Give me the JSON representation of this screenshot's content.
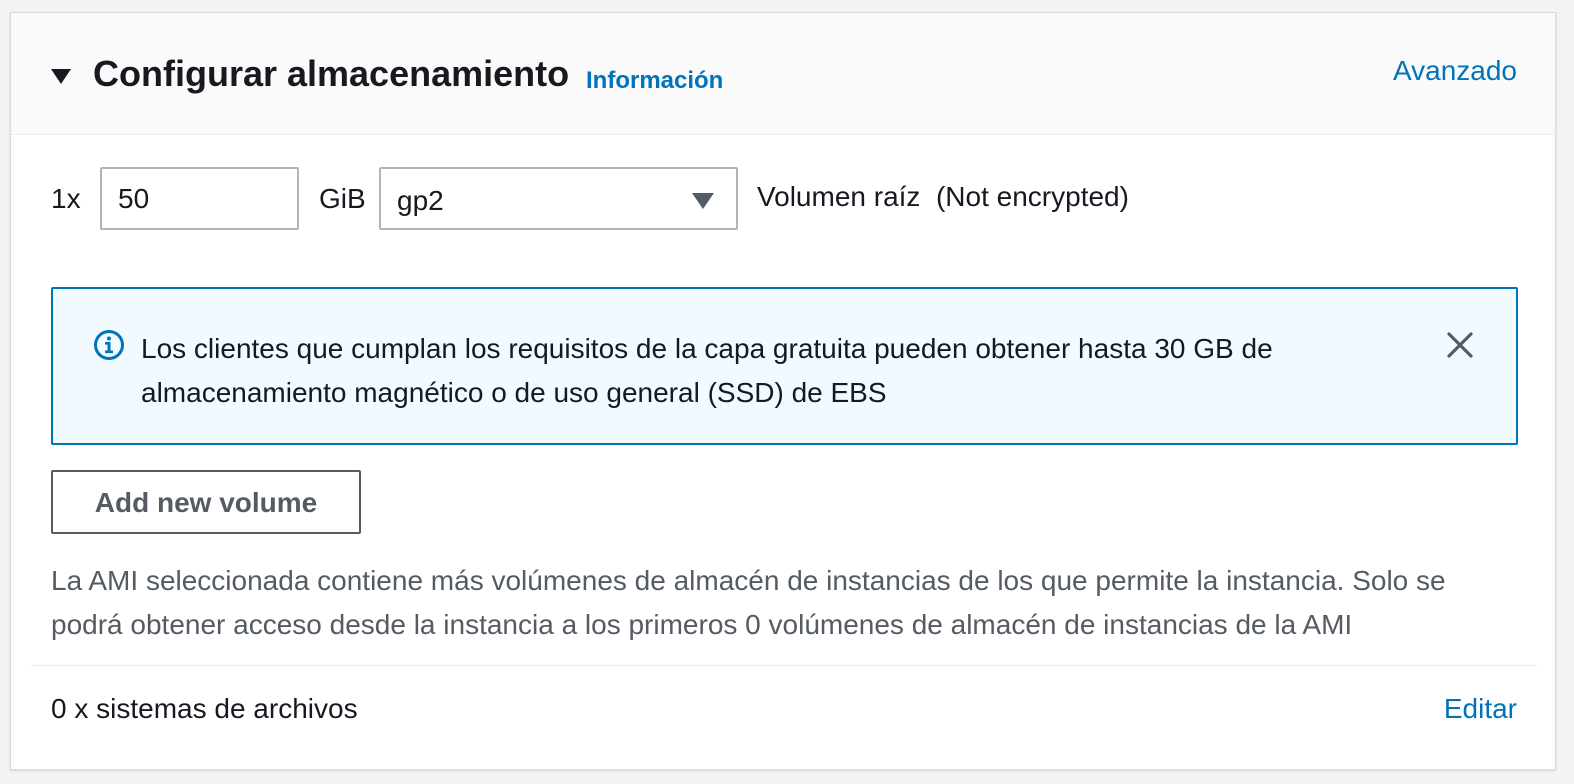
{
  "header": {
    "title": "Configurar almacenamiento",
    "info_link": "Información",
    "advanced_link": "Avanzado"
  },
  "volume": {
    "count_label": "1x",
    "size_value": "50",
    "size_unit": "GiB",
    "type_selected": "gp2",
    "root_label": "Volumen raíz  (Not encrypted)"
  },
  "alert": {
    "icon": "info-icon",
    "message": "Los clientes que cumplan los requisitos de la capa gratuita pueden obtener hasta 30 GB de almacenamiento magnético o de uso general (SSD) de EBS",
    "close_icon": "close-icon"
  },
  "add_volume_label": "Add new volume",
  "ami_note": "La AMI seleccionada contiene más volúmenes de almacén de instancias de los que permite la instancia. Solo se podrá obtener acceso desde la instancia a los primeros 0 volúmenes de almacén de instancias de la AMI",
  "file_systems": {
    "label": "0 x sistemas de archivos",
    "edit_link": "Editar"
  },
  "colors": {
    "link": "#0073bb",
    "alert_bg": "#f1faff",
    "alert_border": "#0073bb",
    "text": "#16191f",
    "muted_text": "#545b64"
  }
}
